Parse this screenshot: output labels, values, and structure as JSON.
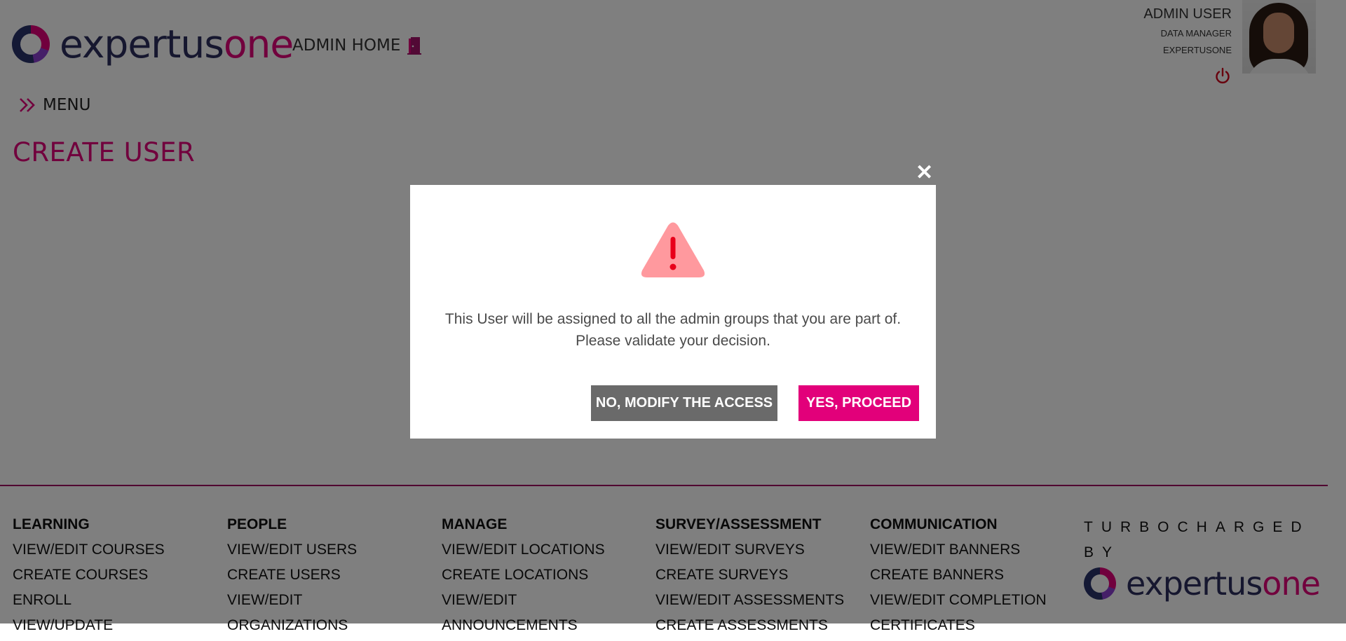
{
  "header": {
    "logo_part1": "expertus",
    "logo_part2": "one",
    "admin_home": "ADMIN HOME",
    "user": {
      "name": "ADMIN USER",
      "role": "DATA MANAGER",
      "org": "EXPERTUSONE"
    },
    "icons": {
      "home": "door-icon",
      "power": "power-icon"
    },
    "accent_color": "#e2007a"
  },
  "menu": {
    "label": "MENU",
    "icon": "chevron-double-right-icon"
  },
  "page": {
    "title": "CREATE USER"
  },
  "modal": {
    "close": "✕",
    "icon": "warning-triangle-icon",
    "message": "This User will be assigned to all the admin groups that you are part of. Please validate your decision.",
    "no_label": "NO, MODIFY THE ACCESS",
    "yes_label": "YES, PROCEED",
    "no_color": "#6a6a6a",
    "yes_color": "#e2007a"
  },
  "footer": {
    "columns": [
      {
        "head": "LEARNING",
        "links": [
          "VIEW/EDIT COURSES",
          "CREATE COURSES",
          "ENROLL",
          "VIEW/UPDATE"
        ]
      },
      {
        "head": "PEOPLE",
        "links": [
          "VIEW/EDIT USERS",
          "CREATE USERS",
          "VIEW/EDIT",
          "ORGANIZATIONS"
        ]
      },
      {
        "head": "MANAGE",
        "links": [
          "VIEW/EDIT LOCATIONS",
          "CREATE LOCATIONS",
          "VIEW/EDIT",
          "ANNOUNCEMENTS"
        ]
      },
      {
        "head": "SURVEY/ASSESSMENT",
        "links": [
          "VIEW/EDIT SURVEYS",
          "CREATE SURVEYS",
          "VIEW/EDIT ASSESSMENTS",
          "CREATE ASSESSMENTS"
        ]
      },
      {
        "head": "COMMUNICATION",
        "links": [
          "VIEW/EDIT BANNERS",
          "CREATE BANNERS",
          "VIEW/EDIT COMPLETION",
          "CERTIFICATES"
        ]
      }
    ],
    "turbo_line1": "TURBOCHARGED",
    "turbo_line2": "BY",
    "logo_part1": "expertus",
    "logo_part2": "one"
  }
}
